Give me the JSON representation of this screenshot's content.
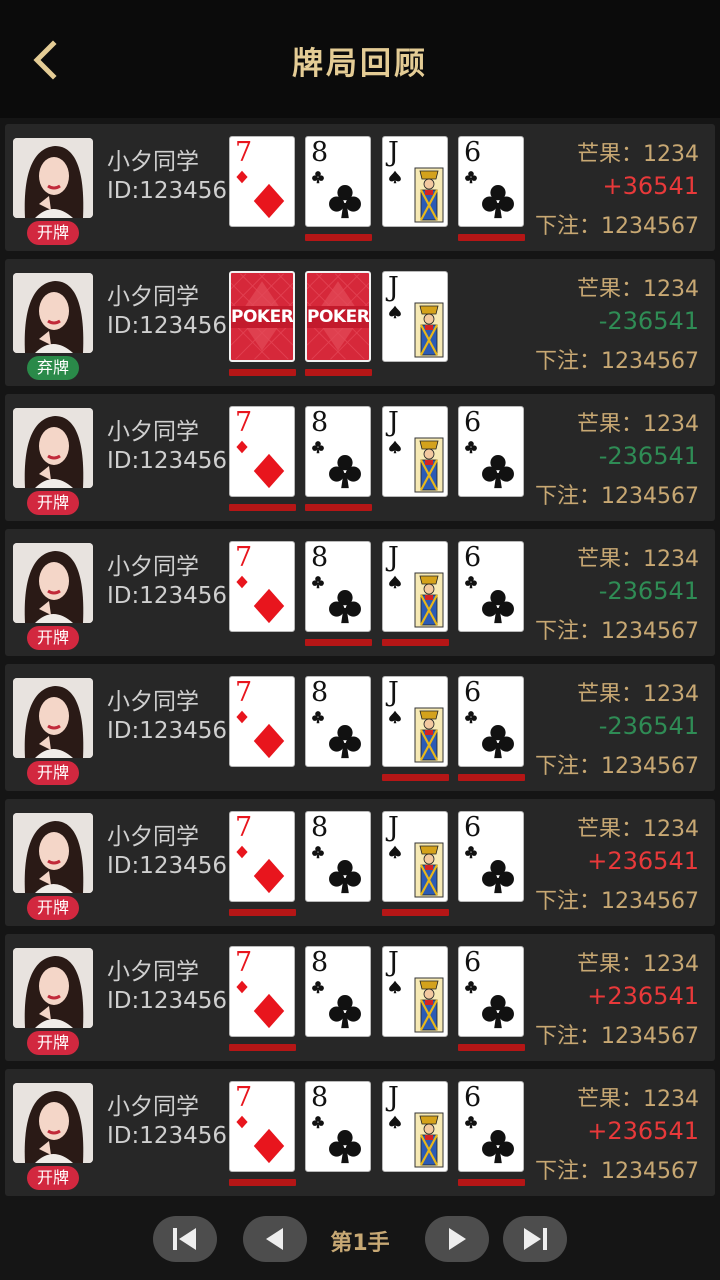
{
  "header": {
    "title": "牌局回顾"
  },
  "rows": [
    {
      "name": "小夕同学",
      "id": "ID:123456",
      "badge": "开牌",
      "badge_type": "open",
      "cards": [
        {
          "rank": "7",
          "suit": "diamond"
        },
        {
          "rank": "8",
          "suit": "club"
        },
        {
          "rank": "J",
          "suit": "spade"
        },
        {
          "rank": "6",
          "suit": "club"
        }
      ],
      "underlines": [
        false,
        true,
        false,
        true
      ],
      "mango": "芒果：1234",
      "delta": "+36541",
      "delta_sign": "pos",
      "bet": "下注：1234567"
    },
    {
      "name": "小夕同学",
      "id": "ID:123456",
      "badge": "弃牌",
      "badge_type": "fold",
      "cards": [
        {
          "rank": "POKER",
          "suit": "back"
        },
        {
          "rank": "POKER",
          "suit": "back"
        },
        {
          "rank": "J",
          "suit": "spade"
        }
      ],
      "underlines": [
        true,
        true,
        false
      ],
      "mango": "芒果：1234",
      "delta": "-236541",
      "delta_sign": "neg",
      "bet": "下注：1234567"
    },
    {
      "name": "小夕同学",
      "id": "ID:123456",
      "badge": "开牌",
      "badge_type": "open",
      "cards": [
        {
          "rank": "7",
          "suit": "diamond"
        },
        {
          "rank": "8",
          "suit": "club"
        },
        {
          "rank": "J",
          "suit": "spade"
        },
        {
          "rank": "6",
          "suit": "club"
        }
      ],
      "underlines": [
        true,
        true,
        false,
        false
      ],
      "mango": "芒果：1234",
      "delta": "-236541",
      "delta_sign": "neg",
      "bet": "下注：1234567"
    },
    {
      "name": "小夕同学",
      "id": "ID:123456",
      "badge": "开牌",
      "badge_type": "open",
      "cards": [
        {
          "rank": "7",
          "suit": "diamond"
        },
        {
          "rank": "8",
          "suit": "club"
        },
        {
          "rank": "J",
          "suit": "spade"
        },
        {
          "rank": "6",
          "suit": "club"
        }
      ],
      "underlines": [
        false,
        true,
        true,
        false
      ],
      "mango": "芒果：1234",
      "delta": "-236541",
      "delta_sign": "neg",
      "bet": "下注：1234567"
    },
    {
      "name": "小夕同学",
      "id": "ID:123456",
      "badge": "开牌",
      "badge_type": "open",
      "cards": [
        {
          "rank": "7",
          "suit": "diamond"
        },
        {
          "rank": "8",
          "suit": "club"
        },
        {
          "rank": "J",
          "suit": "spade"
        },
        {
          "rank": "6",
          "suit": "club"
        }
      ],
      "underlines": [
        false,
        false,
        true,
        true
      ],
      "mango": "芒果：1234",
      "delta": "-236541",
      "delta_sign": "neg",
      "bet": "下注：1234567"
    },
    {
      "name": "小夕同学",
      "id": "ID:123456",
      "badge": "开牌",
      "badge_type": "open",
      "cards": [
        {
          "rank": "7",
          "suit": "diamond"
        },
        {
          "rank": "8",
          "suit": "club"
        },
        {
          "rank": "J",
          "suit": "spade"
        },
        {
          "rank": "6",
          "suit": "club"
        }
      ],
      "underlines": [
        true,
        false,
        true,
        false
      ],
      "mango": "芒果：1234",
      "delta": "+236541",
      "delta_sign": "pos",
      "bet": "下注：1234567"
    },
    {
      "name": "小夕同学",
      "id": "ID:123456",
      "badge": "开牌",
      "badge_type": "open",
      "cards": [
        {
          "rank": "7",
          "suit": "diamond"
        },
        {
          "rank": "8",
          "suit": "club"
        },
        {
          "rank": "J",
          "suit": "spade"
        },
        {
          "rank": "6",
          "suit": "club"
        }
      ],
      "underlines": [
        true,
        false,
        false,
        true
      ],
      "mango": "芒果：1234",
      "delta": "+236541",
      "delta_sign": "pos",
      "bet": "下注：1234567"
    },
    {
      "name": "小夕同学",
      "id": "ID:123456",
      "badge": "开牌",
      "badge_type": "open",
      "cards": [
        {
          "rank": "7",
          "suit": "diamond"
        },
        {
          "rank": "8",
          "suit": "club"
        },
        {
          "rank": "J",
          "suit": "spade"
        },
        {
          "rank": "6",
          "suit": "club"
        }
      ],
      "underlines": [
        true,
        false,
        false,
        true
      ],
      "mango": "芒果：1234",
      "delta": "+236541",
      "delta_sign": "pos",
      "bet": "下注：1234567"
    }
  ],
  "footer": {
    "hand_label": "第1手",
    "buttons": [
      "first-icon",
      "prev-icon",
      "next-icon",
      "last-icon"
    ]
  },
  "colors": {
    "accent_gold": "#c8a873",
    "positive": "#e8393a",
    "negative": "#2f8c55",
    "badge_open": "#d2283f",
    "badge_fold": "#2a8a49"
  }
}
